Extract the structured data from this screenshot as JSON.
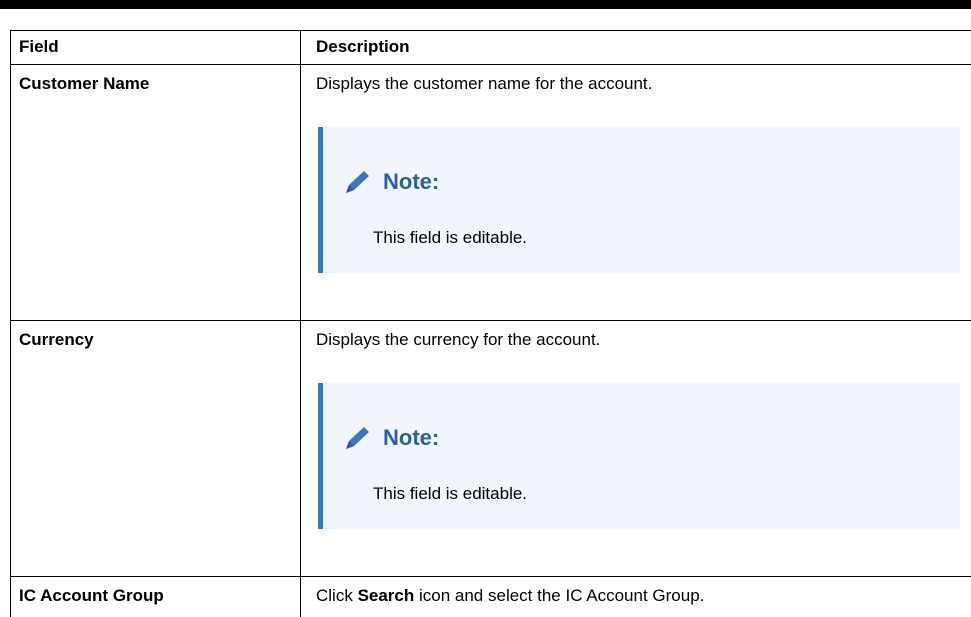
{
  "table": {
    "header": {
      "field": "Field",
      "description": "Description"
    },
    "rows": [
      {
        "field": "Customer Name",
        "description": "Displays the customer name for the account.",
        "note": {
          "title": "Note:",
          "text": "This field is editable."
        }
      },
      {
        "field": "Currency",
        "description": "Displays the currency for the account.",
        "note": {
          "title": "Note:",
          "text": "This field is editable."
        }
      },
      {
        "field": "IC Account Group",
        "description_prefix": "Click ",
        "description_bold": "Search",
        "description_suffix": " icon and select the IC Account Group."
      }
    ]
  },
  "colors": {
    "note_accent": "#3d73bf",
    "note_background": "#f0f5fc",
    "note_title": "#2e5f9d"
  },
  "icons": {
    "note_icon": "pencil-icon"
  }
}
